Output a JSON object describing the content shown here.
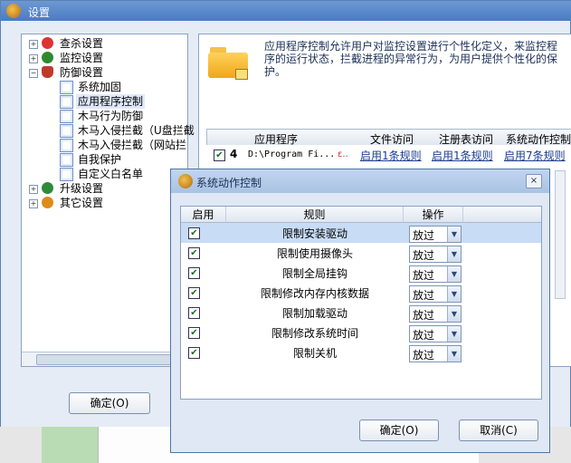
{
  "window": {
    "title": "设置"
  },
  "tree": [
    {
      "label": "查杀设置"
    },
    {
      "label": "监控设置"
    },
    {
      "label": "防御设置"
    },
    {
      "label": "系统加固"
    },
    {
      "label": "应用程序控制"
    },
    {
      "label": "木马行为防御"
    },
    {
      "label": "木马入侵拦截（U盘拦截"
    },
    {
      "label": "木马入侵拦截（网站拦"
    },
    {
      "label": "自我保护"
    },
    {
      "label": "自定义白名单"
    },
    {
      "label": "升级设置"
    },
    {
      "label": "其它设置"
    }
  ],
  "right": {
    "description": "应用程序控制允许用户对监控设置进行个性化定义，来监控程序的运行状态，拦截进程的异常行为，为用户提供个性化的保护。",
    "columns": [
      "应用程序",
      "",
      "文件访问",
      "注册表访问",
      "系统动作控制"
    ],
    "row": {
      "count": "4",
      "path": "D:\\Program Fi...",
      "mark": "ε..",
      "file_access": "启用1条规则",
      "registry_access": "启用1条规则",
      "system_action": "启用7条规则"
    }
  },
  "main_ok": "确定(O)",
  "dialog": {
    "title": "系统动作控制",
    "close": "×",
    "columns": [
      "启用",
      "规则",
      "操作"
    ],
    "rows": [
      {
        "rule": "限制安装驱动",
        "action": "放过"
      },
      {
        "rule": "限制使用摄像头",
        "action": "放过"
      },
      {
        "rule": "限制全局挂钩",
        "action": "放过"
      },
      {
        "rule": "限制修改内存内核数据",
        "action": "放过"
      },
      {
        "rule": "限制加载驱动",
        "action": "放过"
      },
      {
        "rule": "限制修改系统时间",
        "action": "放过"
      },
      {
        "rule": "限制关机",
        "action": "放过"
      }
    ],
    "ok": "确定(O)",
    "cancel": "取消(C)"
  },
  "colors": {
    "title_bar": "#4a7bc4",
    "selected_row": "#c8dcf6",
    "link": "#1a3d8f"
  }
}
